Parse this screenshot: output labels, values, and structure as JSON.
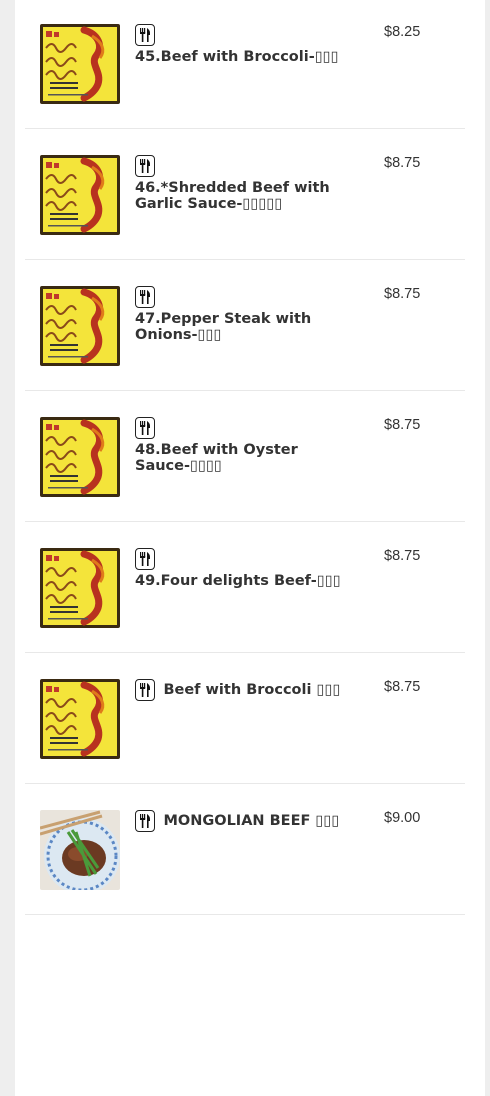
{
  "menu": {
    "items": [
      {
        "name": "45.Beef  with Broccoli-▯▯▯",
        "price": "$8.25",
        "image": "restaurant-logo",
        "inline": false
      },
      {
        "name": "46.*Shredded Beef with Garlic Sauce-▯▯▯▯▯",
        "price": "$8.75",
        "image": "restaurant-logo",
        "inline": false
      },
      {
        "name": "47.Pepper Steak with Onions-▯▯▯",
        "price": "$8.75",
        "image": "restaurant-logo",
        "inline": false
      },
      {
        "name": "48.Beef with Oyster Sauce-▯▯▯▯",
        "price": "$8.75",
        "image": "restaurant-logo",
        "inline": false
      },
      {
        "name": "49.Four delights Beef-▯▯▯",
        "price": "$8.75",
        "image": "restaurant-logo",
        "inline": false
      },
      {
        "name": "Beef with Broccoli ▯▯▯",
        "price": "$8.75",
        "image": "restaurant-logo",
        "inline": true
      },
      {
        "name": "MONGOLIAN BEEF ▯▯▯",
        "price": "$9.00",
        "image": "mongolian-beef-photo",
        "inline": true
      }
    ]
  },
  "icons": {
    "utensils": "fork-knife-icon"
  },
  "colors": {
    "logo_bg": "#f4e43a",
    "logo_text": "#c0392b",
    "logo_border": "#3a2a12",
    "text": "#333333",
    "divider": "#e8e8e8"
  }
}
